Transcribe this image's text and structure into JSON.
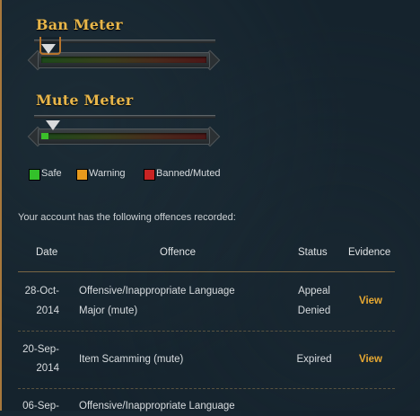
{
  "meters": {
    "ban": {
      "title": "Ban Meter",
      "level": 0.04
    },
    "mute": {
      "title": "Mute Meter",
      "level": 0.04
    }
  },
  "legend": [
    {
      "label": "Safe",
      "color": "#33c12a"
    },
    {
      "label": "Warning",
      "color": "#e89a1c"
    },
    {
      "label": "Banned/Muted",
      "color": "#c92424"
    }
  ],
  "intro": "Your account has the following offences recorded:",
  "table": {
    "headers": {
      "date": "Date",
      "offence": "Offence",
      "status": "Status",
      "evidence": "Evidence"
    },
    "rows": [
      {
        "date_line1": "28-Oct-",
        "date_line2": "2014",
        "offence_line1": "Offensive/Inappropriate Language",
        "offence_line2": "Major (mute)",
        "status_line1": "Appeal",
        "status_line2": "Denied",
        "evidence": "View"
      },
      {
        "date_line1": "20-Sep-",
        "date_line2": "2014",
        "offence_line1": "Item Scamming (mute)",
        "offence_line2": "",
        "status_line1": "Expired",
        "status_line2": "",
        "evidence": "View"
      },
      {
        "date_line1": "06-Sep-",
        "date_line2": "",
        "offence_line1": "Offensive/Inappropriate Language",
        "offence_line2": "",
        "status_line1": "",
        "status_line2": "",
        "evidence": ""
      }
    ]
  },
  "colors": {
    "accent": "#e8b64a",
    "link": "#e8a932",
    "background": "#15232d"
  }
}
